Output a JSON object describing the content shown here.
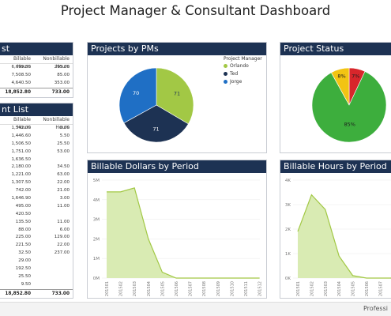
{
  "title": "Project Manager & Consultant Dashboard",
  "pm_list": {
    "title": "st",
    "headers": [
      "Billable Hours",
      "Nonbillable Hours"
    ],
    "rows": [
      {
        "billable": "6,699.50",
        "nonbillable": "295.00"
      },
      {
        "billable": "7,508.50",
        "nonbillable": "85.00"
      },
      {
        "billable": "4,640.50",
        "nonbillable": "353.00"
      }
    ],
    "total": {
      "billable": "18,852.80",
      "nonbillable": "733.00"
    }
  },
  "consultant_list": {
    "title": "nt List",
    "headers": [
      "Billable Hours",
      "Nonbillable Hours"
    ],
    "rows": [
      {
        "billable": "1,542.00",
        "nonbillable": "0.00"
      },
      {
        "billable": "1,446.60",
        "nonbillable": "5.50"
      },
      {
        "billable": "1,506.50",
        "nonbillable": "25.50"
      },
      {
        "billable": "1,751.00",
        "nonbillable": "53.00"
      },
      {
        "billable": "1,636.50",
        "nonbillable": ""
      },
      {
        "billable": "2,180.00",
        "nonbillable": "34.50"
      },
      {
        "billable": "1,221.00",
        "nonbillable": "63.00"
      },
      {
        "billable": "1,307.50",
        "nonbillable": "22.00"
      },
      {
        "billable": "742.00",
        "nonbillable": "21.00"
      },
      {
        "billable": "1,646.90",
        "nonbillable": "3.00"
      },
      {
        "billable": "495.00",
        "nonbillable": "11.00"
      },
      {
        "billable": "420.50",
        "nonbillable": ""
      },
      {
        "billable": "135.50",
        "nonbillable": "11.00"
      },
      {
        "billable": "88.00",
        "nonbillable": "6.00"
      },
      {
        "billable": "225.00",
        "nonbillable": "129.00"
      },
      {
        "billable": "221.50",
        "nonbillable": "22.00"
      },
      {
        "billable": "32.50",
        "nonbillable": "237.00"
      },
      {
        "billable": "29.00",
        "nonbillable": ""
      },
      {
        "billable": "192.50",
        "nonbillable": ""
      },
      {
        "billable": "25.50",
        "nonbillable": ""
      },
      {
        "billable": "9.50",
        "nonbillable": ""
      }
    ],
    "total": {
      "billable": "18,852.80",
      "nonbillable": "733.00"
    }
  },
  "projects_by_pms": {
    "title": "Projects by PMs",
    "legend_title": "Project Manager",
    "chart_data": {
      "type": "pie",
      "slices": [
        {
          "label": "Orlando",
          "value": 71,
          "color": "#a2c845"
        },
        {
          "label": "Ted",
          "value": 71,
          "color": "#1d3253"
        },
        {
          "label": "Jorge",
          "value": 70,
          "color": "#1f6fc5"
        }
      ]
    }
  },
  "project_status": {
    "title": "Project Status",
    "chart_data": {
      "type": "pie",
      "slices": [
        {
          "label": "85%",
          "value": 85,
          "color": "#3dae3d"
        },
        {
          "label": "8%",
          "value": 8,
          "color": "#f2c413"
        },
        {
          "label": "7%",
          "value": 7,
          "color": "#d8262b"
        }
      ]
    }
  },
  "billable_dollars": {
    "title": "Billable Dollars by Period",
    "chart_data": {
      "type": "area",
      "x": [
        "201501",
        "201502",
        "201503",
        "201504",
        "201505",
        "201506",
        "201507",
        "201508",
        "201509",
        "201510",
        "201511",
        "201512"
      ],
      "values": [
        4.4,
        4.4,
        4.6,
        2.0,
        0.3,
        0,
        0,
        0,
        0,
        0,
        0,
        0
      ],
      "ytick_labels": [
        "0M",
        "1M",
        "2M",
        "3M",
        "4M",
        "5M"
      ],
      "ylim": [
        0,
        5
      ],
      "color": "#a2c845"
    }
  },
  "billable_hours": {
    "title": "Billable Hours by Period",
    "chart_data": {
      "type": "area",
      "x": [
        "201501",
        "201502",
        "201503",
        "201504",
        "201505",
        "201506",
        "201507",
        "201508"
      ],
      "values": [
        1.9,
        3.4,
        2.8,
        0.9,
        0.1,
        0,
        0,
        0
      ],
      "ytick_labels": [
        "0K",
        "1K",
        "2K",
        "3K",
        "4K"
      ],
      "ylim": [
        0,
        4
      ],
      "color": "#a2c845"
    }
  },
  "status_bar": {
    "text": "Professi"
  }
}
